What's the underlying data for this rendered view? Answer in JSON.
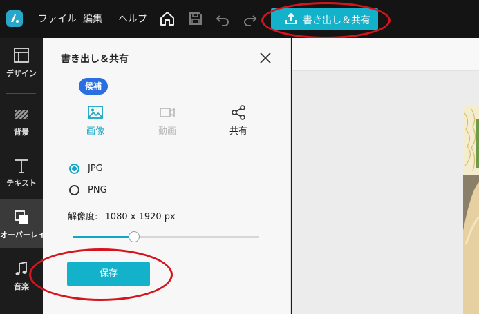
{
  "topbar": {
    "menu": [
      "ファイル",
      "編集",
      "ヘルプ"
    ],
    "export_label": "書き出し＆共有",
    "icons": [
      "app-logo-icon",
      "home-icon",
      "save-disk-icon",
      "undo-icon",
      "redo-icon",
      "upload-icon"
    ]
  },
  "sidebar": {
    "items": [
      {
        "label": "デザイン",
        "icon": "layout-icon"
      },
      {
        "label": "背景",
        "icon": "hatch-icon"
      },
      {
        "label": "テキスト",
        "icon": "text-t-icon"
      },
      {
        "label": "オーバーレイ",
        "icon": "overlay-icon",
        "active": true
      },
      {
        "label": "音楽",
        "icon": "music-note-icon"
      }
    ]
  },
  "panel": {
    "title": "書き出し＆共有",
    "badge": "候補",
    "tabs": [
      {
        "label": "画像",
        "icon": "image-icon",
        "state": "active"
      },
      {
        "label": "動画",
        "icon": "video-icon",
        "state": "disabled"
      },
      {
        "label": "共有",
        "icon": "share-icon",
        "state": "normal"
      }
    ],
    "formats": [
      {
        "label": "JPG",
        "checked": true
      },
      {
        "label": "PNG",
        "checked": false
      }
    ],
    "resolution_label": "解像度:",
    "resolution_value": "1080 x 1920 px",
    "slider_fraction": 0.33,
    "save_label": "保存"
  },
  "colors": {
    "accent": "#14b2ca",
    "badge": "#2a6fe0",
    "annotation_ring": "#d6141d",
    "topbar_bg": "#141414"
  }
}
